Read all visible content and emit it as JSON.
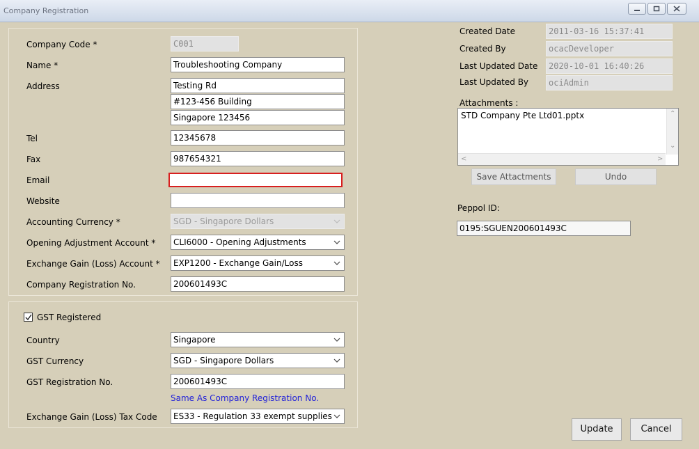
{
  "window": {
    "title": "Company Registration",
    "minimize_icon": "minimize-icon",
    "maximize_icon": "maximize-icon",
    "close_icon": "close-icon"
  },
  "company": {
    "code_label": "Company Code *",
    "code_value": "C001",
    "name_label": "Name *",
    "name_value": "Troubleshooting Company",
    "address_label": "Address",
    "address_line1": "Testing Rd",
    "address_line2": "#123-456 Building",
    "address_line3": "Singapore 123456",
    "tel_label": "Tel",
    "tel_value": "12345678",
    "fax_label": "Fax",
    "fax_value": "987654321",
    "email_label": "Email",
    "email_value": "",
    "website_label": "Website",
    "website_value": "",
    "accounting_currency_label": "Accounting Currency *",
    "accounting_currency_value": "SGD - Singapore Dollars",
    "opening_adjustment_label": "Opening Adjustment Account *",
    "opening_adjustment_value": "CLI6000 - Opening Adjustments",
    "exchange_gain_label": "Exchange Gain (Loss) Account *",
    "exchange_gain_value": "EXP1200 - Exchange Gain/Loss",
    "registration_no_label": "Company Registration No.",
    "registration_no_value": "200601493C"
  },
  "gst": {
    "registered_label": "GST Registered",
    "registered_checked": true,
    "country_label": "Country",
    "country_value": "Singapore",
    "currency_label": "GST Currency",
    "currency_value": "SGD - Singapore Dollars",
    "registration_no_label": "GST Registration No.",
    "registration_no_value": "200601493C",
    "same_as_link": "Same As Company Registration No.",
    "tax_code_label": "Exchange Gain (Loss) Tax Code",
    "tax_code_value": "ES33 - Regulation 33 exempt supplies"
  },
  "audit": {
    "created_date_label": "Created Date",
    "created_date_value": "2011-03-16 15:37:41",
    "created_by_label": "Created By",
    "created_by_value": "ocacDeveloper",
    "last_updated_date_label": "Last Updated Date",
    "last_updated_date_value": "2020-10-01 16:40:26",
    "last_updated_by_label": "Last Updated By",
    "last_updated_by_value": "ociAdmin"
  },
  "attachments": {
    "label": "Attachments :",
    "items": [
      "STD Company Pte Ltd01.pptx"
    ],
    "save_button": "Save Attactments",
    "undo_button": "Undo"
  },
  "peppol": {
    "label": "Peppol ID:",
    "value": "0195:SGUEN200601493C"
  },
  "actions": {
    "update_button": "Update",
    "cancel_button": "Cancel"
  },
  "colors": {
    "window_background": "#d6cfb9",
    "error_border": "#d81f1f",
    "link": "#2323d8"
  }
}
